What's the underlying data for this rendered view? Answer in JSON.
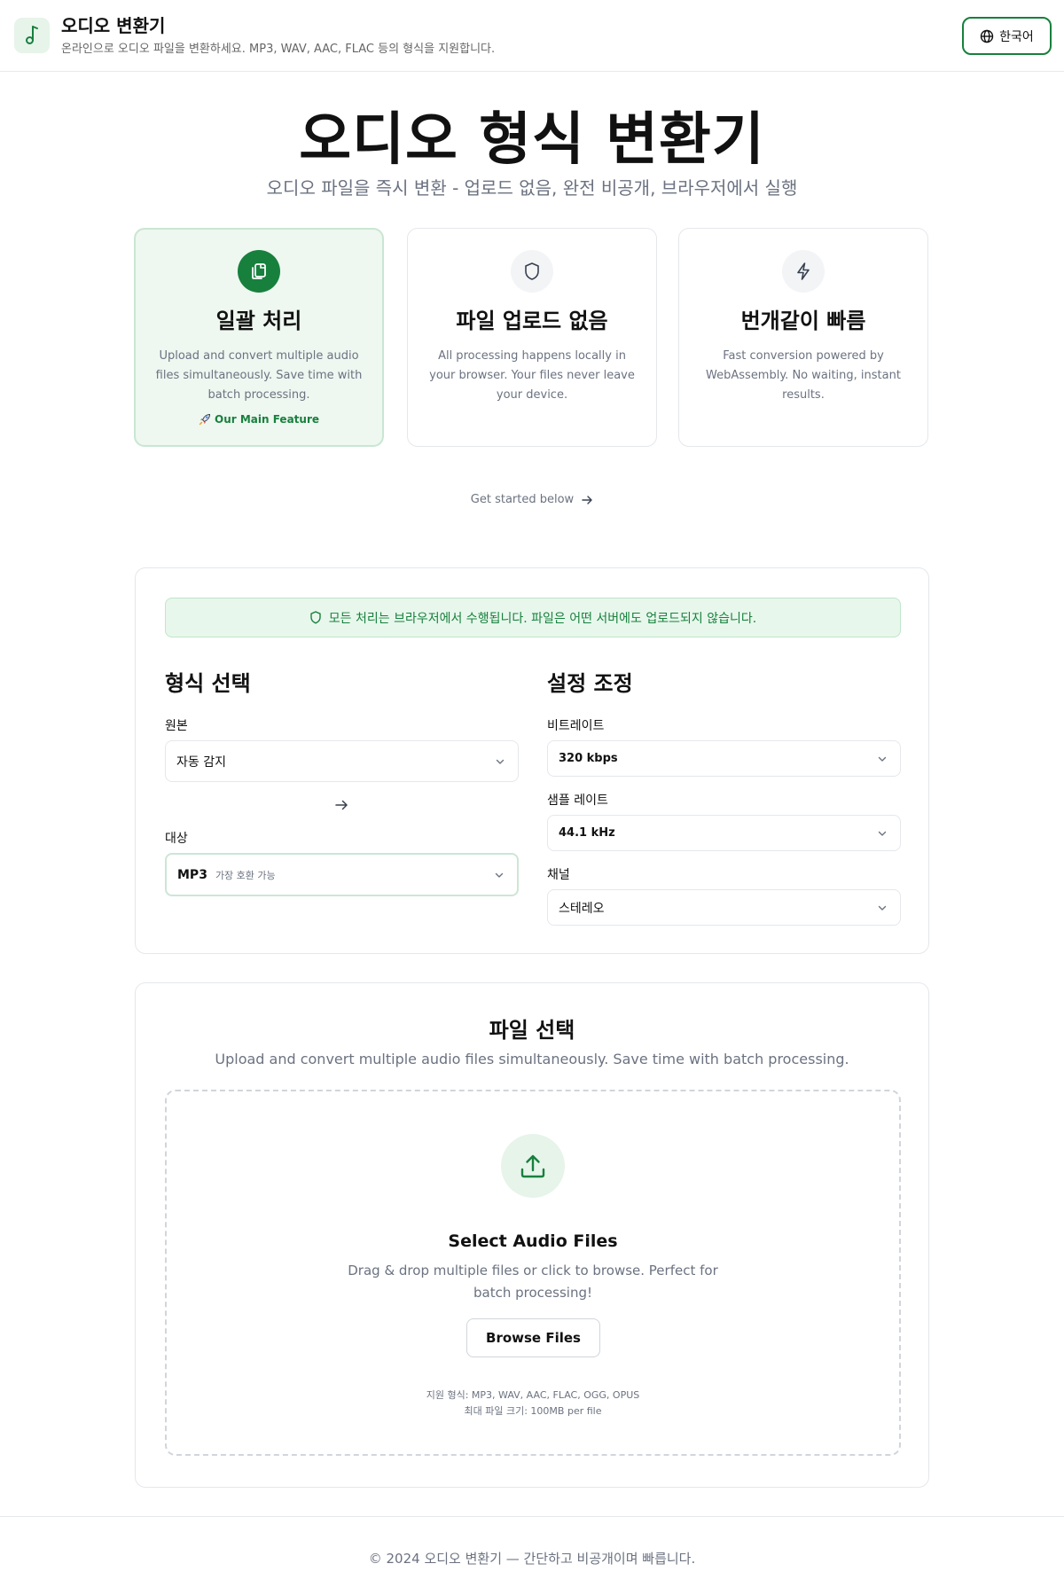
{
  "header": {
    "title": "오디오 변환기",
    "subtitle": "온라인으로 오디오 파일을 변환하세요. MP3, WAV, AAC, FLAC 등의 형식을 지원합니다.",
    "language_label": "한국어",
    "logo_icon": "music-note-icon"
  },
  "hero": {
    "title": "오디오 형식 변환기",
    "subtitle": "오디오 파일을 즉시 변환 - 업로드 없음, 완전 비공개, 브라우저에서 실행"
  },
  "features": [
    {
      "title": "일괄 처리",
      "description": "Upload and convert multiple audio files simultaneously. Save time with batch processing.",
      "badge": "Our Main Feature",
      "icon": "files-icon"
    },
    {
      "title": "파일 업로드 없음",
      "description": "All processing happens locally in your browser. Your files never leave your device.",
      "icon": "shield-icon"
    },
    {
      "title": "번개같이 빠름",
      "description": "Fast conversion powered by WebAssembly. No waiting, instant results.",
      "icon": "lightning-icon"
    }
  ],
  "get_started": "Get started below",
  "settings": {
    "notice": "모든 처리는 브라우저에서 수행됩니다. 파일은 어떤 서버에도 업로드되지 않습니다.",
    "format_title": "형식 선택",
    "source_label": "원본",
    "source_value": "자동 감지",
    "target_label": "대상",
    "target_value": "MP3",
    "target_hint": "가장 호환 가능",
    "adjust_title": "설정 조정",
    "bitrate_label": "비트레이트",
    "bitrate_value": "320 kbps",
    "samplerate_label": "샘플 레이트",
    "samplerate_value": "44.1 kHz",
    "channel_label": "채널",
    "channel_value": "스테레오"
  },
  "file_select": {
    "title": "파일 선택",
    "subtitle": "Upload and convert multiple audio files simultaneously. Save time with batch processing.",
    "drop_title": "Select Audio Files",
    "drop_desc_line1": "Drag & drop multiple files or click to browse. Perfect for",
    "drop_desc_line2": "batch processing!",
    "browse_label": "Browse Files",
    "supported_formats": "지원 형식: MP3, WAV, AAC, FLAC, OGG, OPUS",
    "max_size": "최대 파일 크기: 100MB per file"
  },
  "footer": {
    "text": "© 2024 오디오 변환기 — 간단하고 비공개이며 빠릅니다."
  },
  "colors": {
    "accent": "#17803d",
    "accent_light": "#e6f4ea",
    "muted_text": "#6b7280"
  }
}
